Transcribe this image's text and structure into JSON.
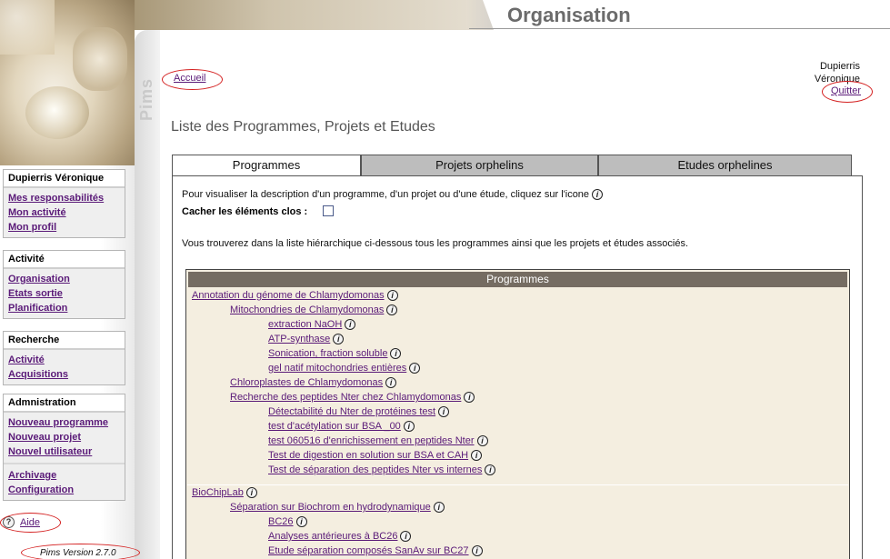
{
  "header": {
    "title": "Organisation",
    "strip_label": "Pims"
  },
  "user": {
    "name_line1": "Dupierris",
    "name_line2": "Véronique",
    "logout": "Quitter"
  },
  "breadcrumb": {
    "home": "Accueil"
  },
  "page": {
    "title": "Liste des Programmes, Projets et Etudes"
  },
  "sidebar": {
    "user_menu": {
      "title": "Dupierris Véronique",
      "items": [
        "Mes responsabilités",
        "Mon activité",
        "Mon profil"
      ]
    },
    "activity_menu": {
      "title": "Activité",
      "items": [
        "Organisation",
        "Etats sortie",
        "Planification"
      ]
    },
    "search_menu": {
      "title": "Recherche",
      "items": [
        "Activité",
        "Acquisitions"
      ]
    },
    "admin_menu": {
      "title": "Admnistration",
      "items": [
        "Nouveau programme",
        "Nouveau projet",
        "Nouvel utilisateur"
      ],
      "items2": [
        "Archivage",
        "Configuration"
      ]
    },
    "help": "Aide",
    "version": "Pims Version 2.7.0"
  },
  "tabs": [
    "Programmes",
    "Projets orphelins",
    "Etudes orphelines"
  ],
  "content": {
    "instructions": "Pour visualiser la description d'un programme, d'un projet ou d'une étude, cliquez sur l'icone",
    "hide_closed": "Cacher les éléments clos :",
    "hierarchy_note": "Vous trouverez dans la liste hiérarchique ci-dessous tous les programmes ainsi que les projets et études associés.",
    "table_header": "Programmes"
  },
  "programs": [
    {
      "label": "Annotation du génome de Chlamydomonas",
      "level": 0
    },
    {
      "label": "Mitochondries de Chlamydomonas",
      "level": 1
    },
    {
      "label": "extraction NaOH",
      "level": 2
    },
    {
      "label": "ATP-synthase",
      "level": 2
    },
    {
      "label": "Sonication, fraction soluble",
      "level": 2
    },
    {
      "label": "gel natif mitochondries entières",
      "level": 2
    },
    {
      "label": "Chloroplastes de Chlamydomonas",
      "level": 1
    },
    {
      "label": "Recherche des peptides Nter chez Chlamydomonas",
      "level": 1
    },
    {
      "label": "Détectabilité du Nter de protéines test",
      "level": 2
    },
    {
      "label": "test d'acétylation sur BSA _00",
      "level": 2
    },
    {
      "label": "test 060516 d'enrichissement en peptides Nter",
      "level": 2
    },
    {
      "label": "Test de digestion en solution sur BSA et CAH",
      "level": 2
    },
    {
      "label": "Test de séparation des peptides Nter vs internes",
      "level": 2
    },
    {
      "label": "BioChipLab",
      "level": 0
    },
    {
      "label": "Séparation sur Biochrom en hydrodynamique",
      "level": 1
    },
    {
      "label": "BC26",
      "level": 2
    },
    {
      "label": "Analyses antérieures à BC26",
      "level": 2
    },
    {
      "label": "Etude séparation composés SanAv sur BC27",
      "level": 2
    }
  ],
  "colors": {
    "link": "#5a1a78",
    "table_bg": "#f4eee0",
    "table_header": "#756c62",
    "annotation": "#d42020"
  },
  "icons": {
    "info": "info-icon",
    "help": "help-icon"
  }
}
